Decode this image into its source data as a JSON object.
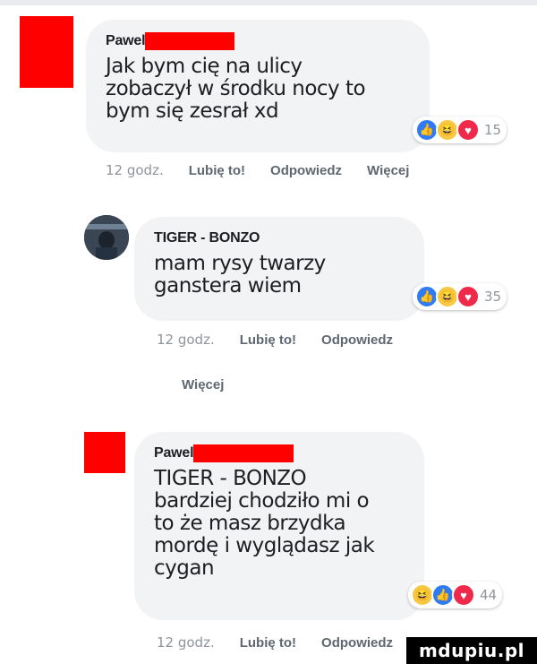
{
  "comments": [
    {
      "author": "Pawel",
      "text": "Jak bym cię na ulicy\nzobaczył w środku nocy to\nbym się zesrał xd",
      "reaction_count": "15",
      "time": "12 godz.",
      "like": "Lubię to!",
      "reply": "Odpowiedz",
      "more": "Więcej"
    },
    {
      "author": "TIGER - BONZO",
      "text": "mam rysy twarzy\nganstera wiem",
      "reaction_count": "35",
      "time": "12 godz.",
      "like": "Lubię to!",
      "reply": "Odpowiedz",
      "more": "Więcej"
    },
    {
      "author": "Pawel",
      "text": "TIGER - BONZO\nbardziej chodziło mi o\nto że masz brzydka\nmordę i wyglądasz jak\ncygan",
      "reaction_count": "44",
      "time": "12 godz.",
      "like": "Lubię to!",
      "reply": "Odpowiedz"
    }
  ],
  "watermark": "mdupiu.pl",
  "colors": {
    "redaction": "#ff0000",
    "bubble": "#f2f3f5",
    "like": "#2e7bf3",
    "love": "#f0284a",
    "haha": "#f7c843"
  }
}
